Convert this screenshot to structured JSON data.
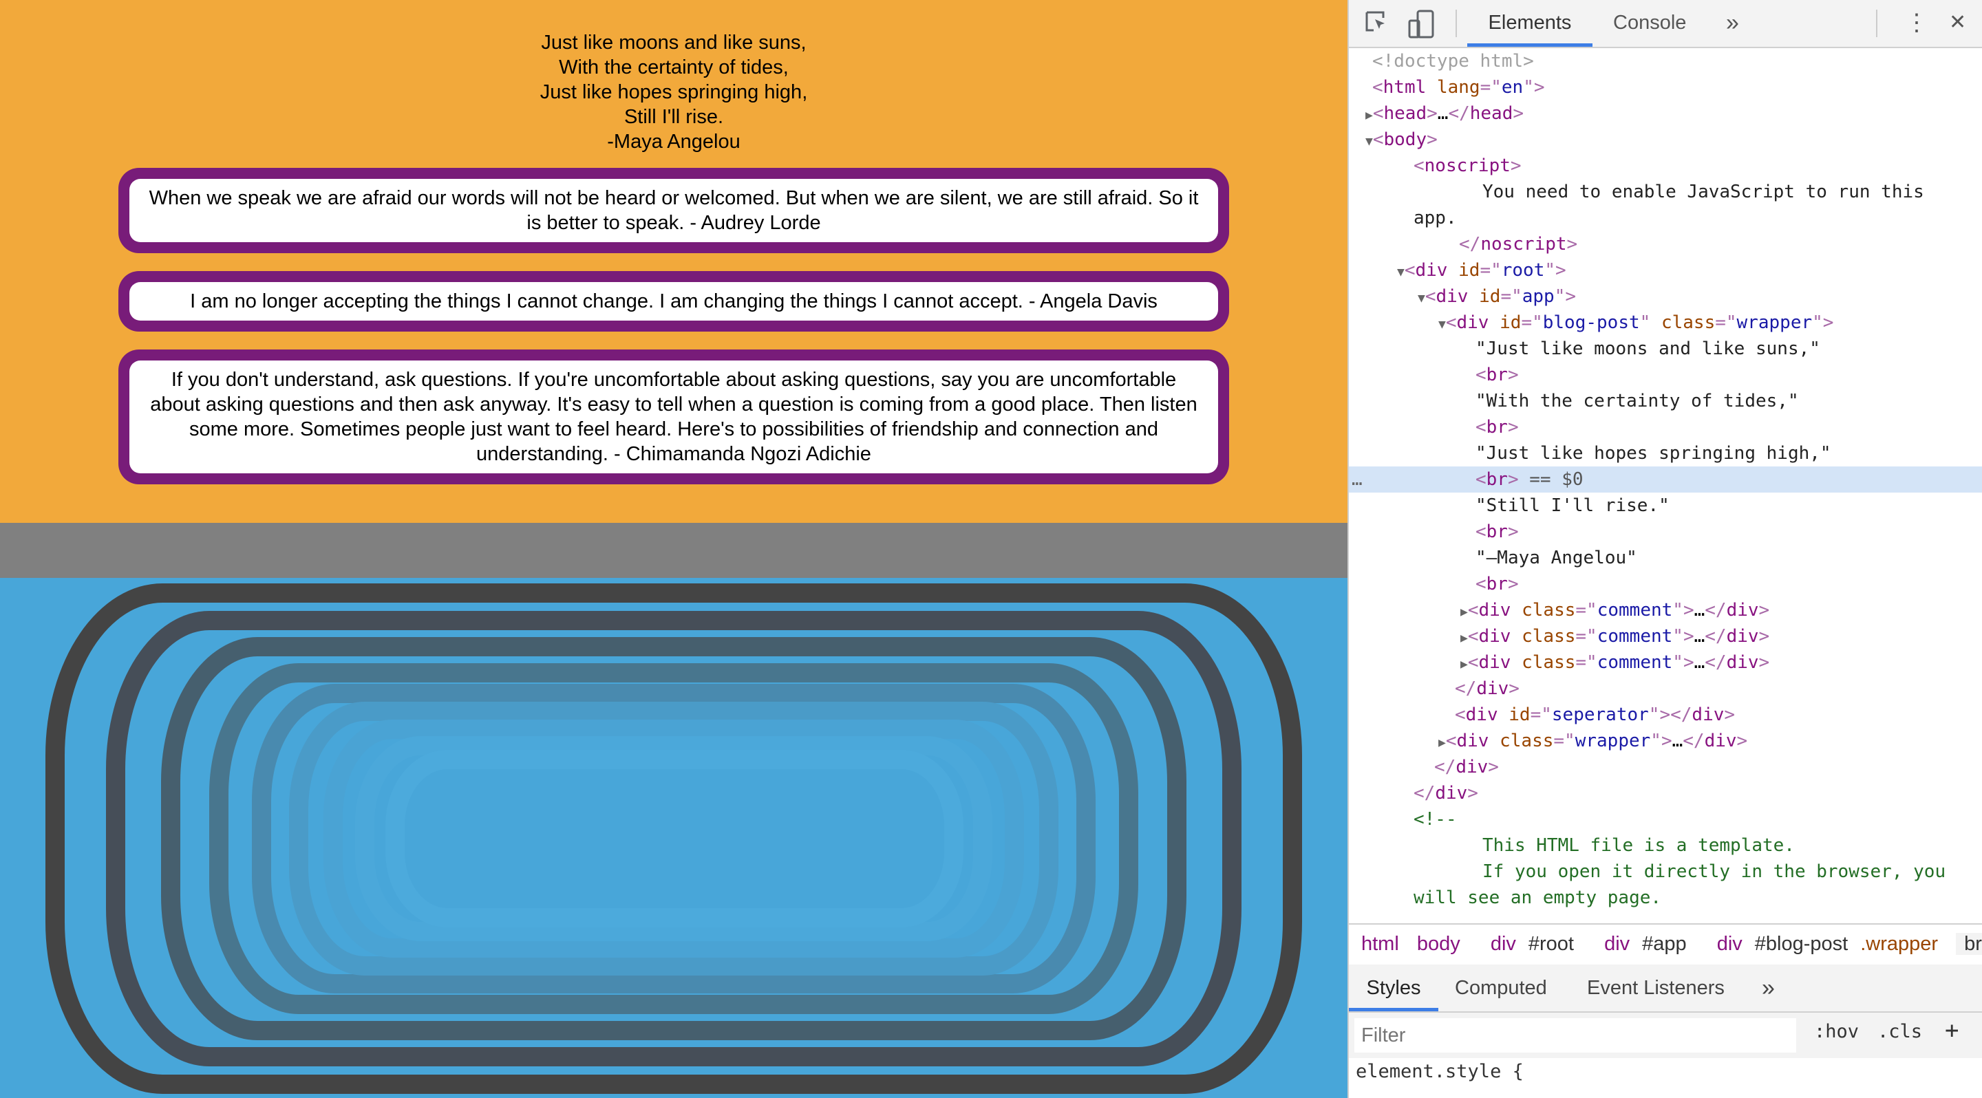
{
  "page": {
    "poem_lines": [
      "Just like moons and like suns,",
      "With the certainty of tides,",
      "Just like hopes springing high,",
      "Still I'll rise.",
      "-Maya Angelou"
    ],
    "comments": [
      "When we speak we are afraid our words will not be heard or welcomed. But when we are silent, we are still afraid. So it is better to speak. - Audrey Lorde",
      "I am no longer accepting the things I cannot change. I am changing the things I cannot accept. - Angela Davis",
      "If you don't understand, ask questions. If you're uncomfortable about asking questions, say you are uncomfortable about asking questions and then ask anyway. It's easy to tell when a question is coming from a good place. Then listen some more. Sometimes people just want to feel heard. Here's to possibilities of friendship and connection and understanding. - Chimamanda Ngozi Adichie"
    ],
    "colors": {
      "blog_bg": "#f2a93b",
      "comment_border": "#781c79",
      "separator": "#808080",
      "wrapper_bg": "#48a6d9",
      "ring": "#444444"
    }
  },
  "devtools": {
    "tabs": {
      "elements": "Elements",
      "console": "Console",
      "more": "»"
    },
    "icons": {
      "inspect": "inspect-element-icon",
      "device": "device-toolbar-icon",
      "menu": "⋮",
      "close": "✕"
    },
    "dom": {
      "doctype": "<!doctype html>",
      "html": "html",
      "lang_attr": "lang",
      "lang_val": "en",
      "head": "head",
      "body": "body",
      "noscript": "noscript",
      "noscript_text": "You need to enable JavaScript to run this",
      "noscript_text2": "app.",
      "root_id": "root",
      "app_id": "app",
      "blog_id": "blog-post",
      "wrapper_cls": "wrapper",
      "text1": "\"Just like moons and like suns,\"",
      "text2": "\"With the certainty of tides,\"",
      "text3": "\"Just like hopes springing high,\"",
      "text4": "\"Still I'll rise.\"",
      "text5": "\"–Maya Angelou\"",
      "selected_marker": "== $0",
      "comment_cls": "comment",
      "sep_id": "seperator",
      "comment_open": "<!--",
      "comment_line1": "This HTML file is a template.",
      "comment_line2": "If you open it directly in the browser, you",
      "comment_line3": "will see an empty page."
    },
    "breadcrumbs": {
      "html": "html",
      "body": "body",
      "root_tag": "div",
      "root_id": "#root",
      "app_tag": "div",
      "app_id": "#app",
      "blog_tag": "div",
      "blog_id": "#blog-post",
      "blog_cls": ".wrapper",
      "br": "br"
    },
    "subtabs": {
      "styles": "Styles",
      "computed": "Computed",
      "listeners": "Event Listeners",
      "more": "»"
    },
    "filter_placeholder": "Filter",
    "hov": ":hov",
    "cls": ".cls",
    "plus": "+",
    "element_style": "element.style {"
  }
}
